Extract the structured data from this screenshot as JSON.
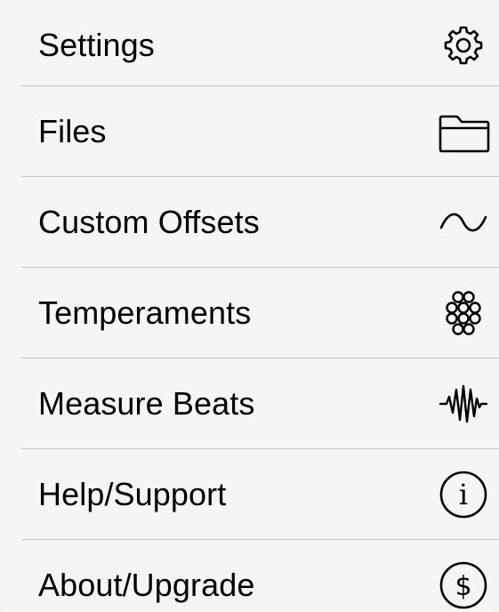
{
  "menu": {
    "items": [
      {
        "label": "Settings",
        "icon": "gear-icon"
      },
      {
        "label": "Files",
        "icon": "folder-icon"
      },
      {
        "label": "Custom Offsets",
        "icon": "tilde-wave-icon"
      },
      {
        "label": "Temperaments",
        "icon": "flower-circles-icon"
      },
      {
        "label": "Measure Beats",
        "icon": "waveform-icon"
      },
      {
        "label": "Help/Support",
        "icon": "info-circle-icon"
      },
      {
        "label": "About/Upgrade",
        "icon": "dollar-circle-icon"
      }
    ],
    "info_glyph": "i",
    "dollar_glyph": "$"
  }
}
